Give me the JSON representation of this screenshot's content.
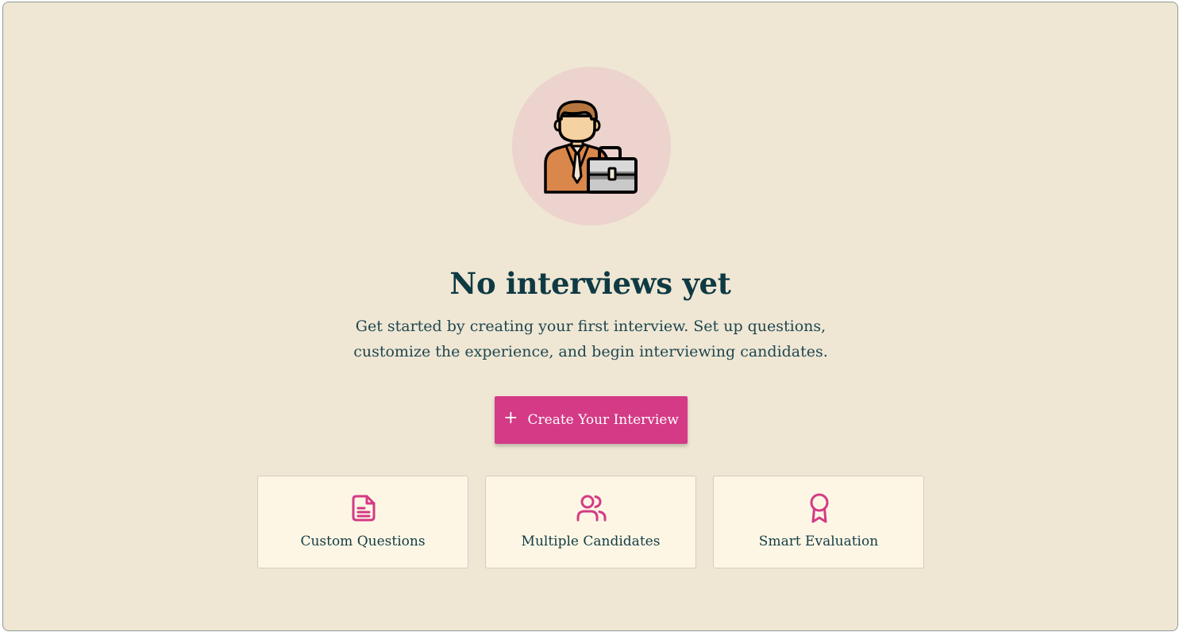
{
  "empty_state": {
    "title": "No interviews yet",
    "subtitle_line1": "Get started by creating your first interview. Set up questions,",
    "subtitle_line2": "customize the experience, and begin interviewing candidates.",
    "illustration_icon": "businessman-with-briefcase-icon"
  },
  "cta": {
    "icon": "plus-icon",
    "label": "Create Your Interview"
  },
  "features": [
    {
      "icon": "document-icon",
      "label": "Custom Questions"
    },
    {
      "icon": "users-icon",
      "label": "Multiple Candidates"
    },
    {
      "icon": "award-icon",
      "label": "Smart Evaluation"
    }
  ],
  "colors": {
    "background": "#efe7d4",
    "accent": "#d43a86",
    "text": "#123b45",
    "card": "#fdf6e4",
    "illustration_circle": "#ecd3cd"
  }
}
